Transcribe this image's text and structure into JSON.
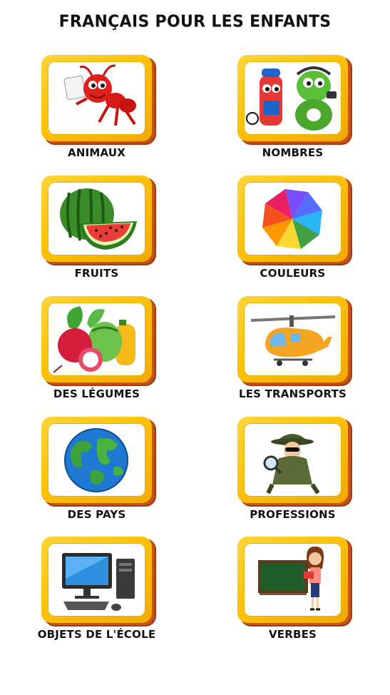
{
  "header": {
    "title": "FRANÇAIS POUR LES ENFANTS"
  },
  "categories": [
    {
      "label": "ANIMAUX",
      "icon": "ant-icon"
    },
    {
      "label": "NOMBRES",
      "icon": "numbers-icon"
    },
    {
      "label": "FRUITS",
      "icon": "watermelon-icon"
    },
    {
      "label": "COULEURS",
      "icon": "color-wheel-icon"
    },
    {
      "label": "DES LÉGUMES",
      "icon": "vegetables-icon"
    },
    {
      "label": "LES TRANSPORTS",
      "icon": "helicopter-icon"
    },
    {
      "label": "DES PAYS",
      "icon": "globe-icon"
    },
    {
      "label": "PROFESSIONS",
      "icon": "detective-icon"
    },
    {
      "label": "OBJETS DE L'ÉCOLE",
      "icon": "computer-icon"
    },
    {
      "label": "VERBES",
      "icon": "teacher-icon"
    }
  ],
  "colors": {
    "card_yellow": "#ffc107",
    "card_shadow": "#c6521a",
    "text": "#111111"
  }
}
